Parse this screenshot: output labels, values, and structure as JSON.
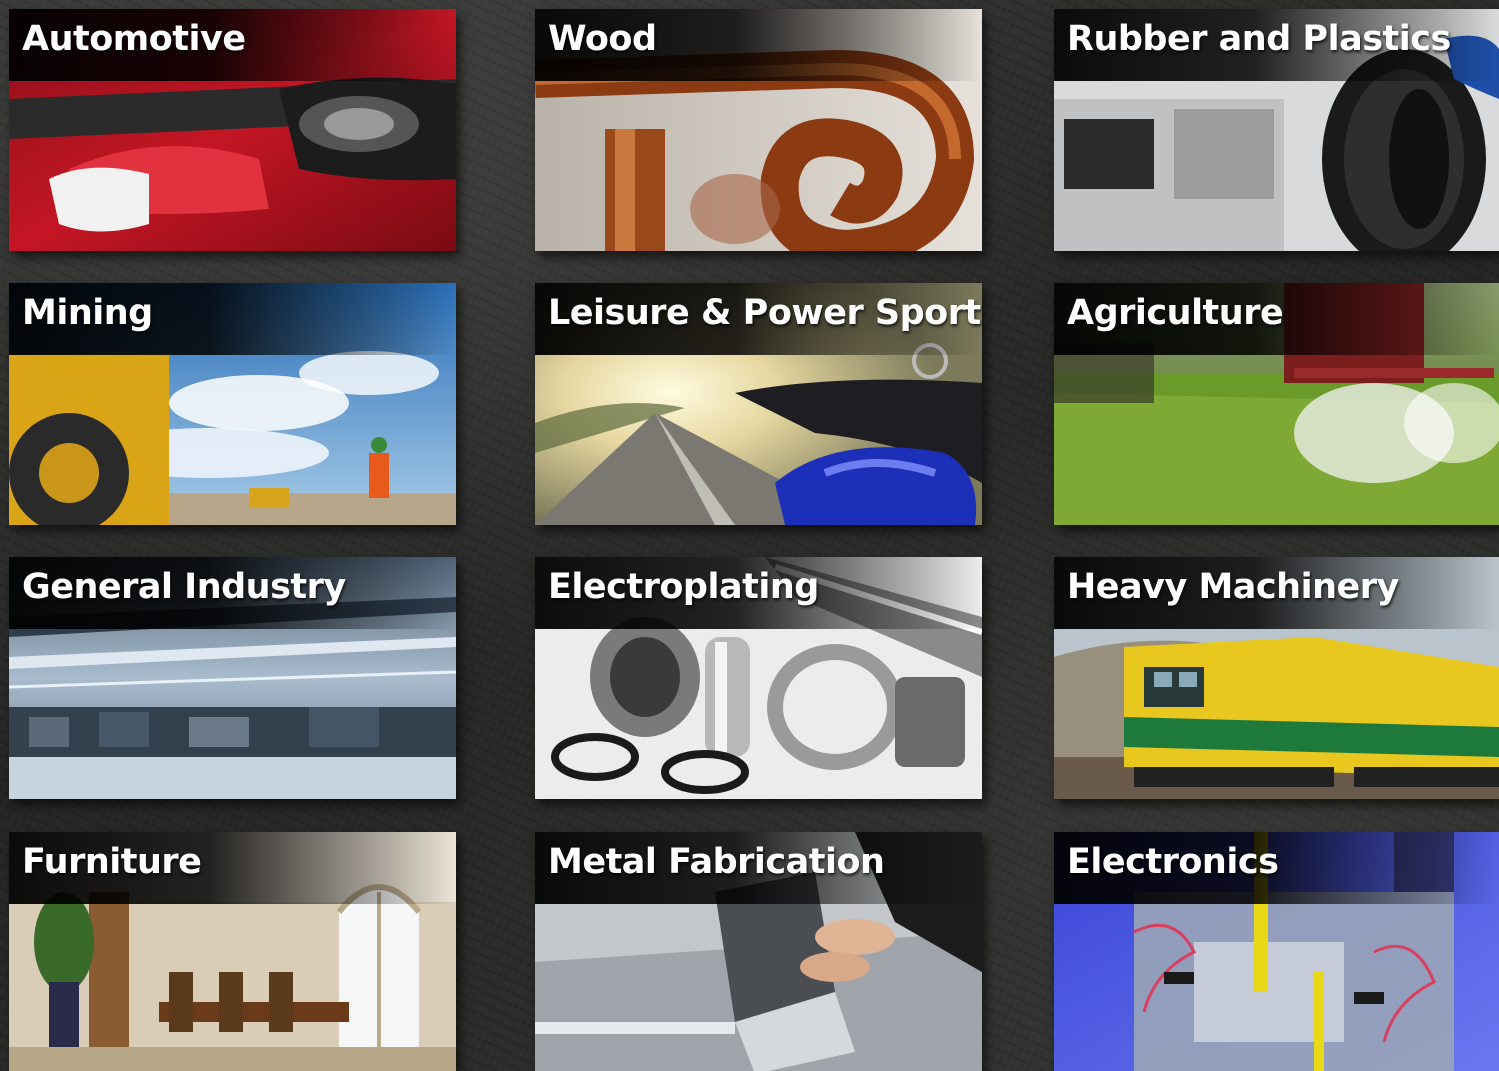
{
  "tiles": [
    {
      "label": "Automotive"
    },
    {
      "label": "Wood"
    },
    {
      "label": "Rubber and Plastics"
    },
    {
      "label": "Mining"
    },
    {
      "label": "Leisure & Power Sports"
    },
    {
      "label": "Agriculture"
    },
    {
      "label": "General Industry"
    },
    {
      "label": "Electroplating"
    },
    {
      "label": "Heavy Machinery"
    },
    {
      "label": "Furniture"
    },
    {
      "label": "Metal Fabrication"
    },
    {
      "label": "Electronics"
    }
  ]
}
